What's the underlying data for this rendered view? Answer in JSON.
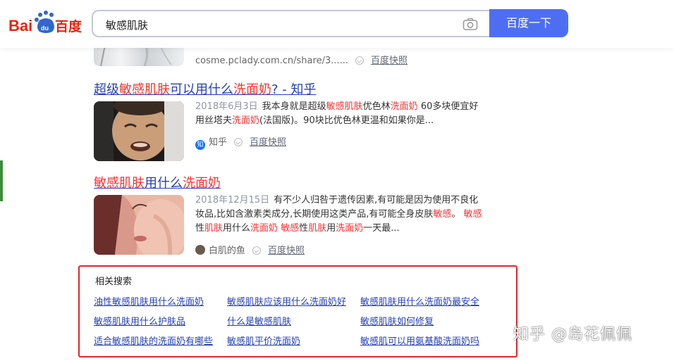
{
  "header": {
    "logo_text": "Bai百度",
    "search_query": "敏感肌肤",
    "search_button": "百度一下"
  },
  "results": [
    {
      "source_url": "cosme.pclady.com.cn/share/3......",
      "kuaizhao": "百度快照"
    },
    {
      "title_parts": [
        {
          "text": "超级",
          "hl": false
        },
        {
          "text": "敏感肌肤",
          "hl": true
        },
        {
          "text": "可以用什么",
          "hl": false
        },
        {
          "text": "洗面奶",
          "hl": true
        },
        {
          "text": "? - 知乎",
          "hl": false
        }
      ],
      "date": "2018年6月3日",
      "abstract_parts": [
        {
          "text": "我本身就是超级",
          "hl": false
        },
        {
          "text": "敏感肌肤",
          "hl": true
        },
        {
          "text": "优色林",
          "hl": false
        },
        {
          "text": "洗面奶",
          "hl": true
        },
        {
          "text": " 60多块便宜好用丝塔夫",
          "hl": false
        },
        {
          "text": "洗面奶",
          "hl": true
        },
        {
          "text": "(法国版)。90块比优色林更温和如果你是...",
          "hl": false
        }
      ],
      "source": "知乎",
      "source_icon_text": "知",
      "kuaizhao": "百度快照"
    },
    {
      "title_parts": [
        {
          "text": "敏感肌肤",
          "hl": true
        },
        {
          "text": "用什么",
          "hl": false
        },
        {
          "text": "洗面奶",
          "hl": true
        }
      ],
      "date": "2018年12月15日",
      "abstract_parts": [
        {
          "text": "有不少人归咎于遗传因素,有可能是因为使用不良化妆品,比如含激素类成分,长期使用这类产品,有可能全身皮肤",
          "hl": false
        },
        {
          "text": "敏感",
          "hl": true
        },
        {
          "text": "。 ",
          "hl": false
        },
        {
          "text": "敏感",
          "hl": true
        },
        {
          "text": "性",
          "hl": false
        },
        {
          "text": "肌肤",
          "hl": true
        },
        {
          "text": "用什么",
          "hl": false
        },
        {
          "text": "洗面奶",
          "hl": true
        },
        {
          "text": " ",
          "hl": false
        },
        {
          "text": "敏感",
          "hl": true
        },
        {
          "text": "性",
          "hl": false
        },
        {
          "text": "肌肤",
          "hl": true
        },
        {
          "text": "用",
          "hl": false
        },
        {
          "text": "洗面奶",
          "hl": true
        },
        {
          "text": "一天最...",
          "hl": false
        }
      ],
      "source": "白肌的鱼",
      "kuaizhao": "百度快照"
    }
  ],
  "related": {
    "title": "相关搜索",
    "links": [
      "油性敏感肌肤用什么洗面奶",
      "敏感肌肤应该用什么洗面奶好",
      "敏感肌肤用什么洗面奶最安全",
      "敏感肌肤用什么护肤品",
      "什么是敏感肌肤",
      "敏感肌肤如何修复",
      "适合敏感肌肤的洗面奶有哪些",
      "敏感肌平价洗面奶",
      "敏感肌可以用氨基酸洗面奶吗"
    ]
  },
  "watermark": "知乎 @岛花佩佩",
  "colors": {
    "link": "#2440b3",
    "highlight": "#f73131",
    "search_button": "#4e6ef2",
    "related_border": "#e0262a"
  }
}
